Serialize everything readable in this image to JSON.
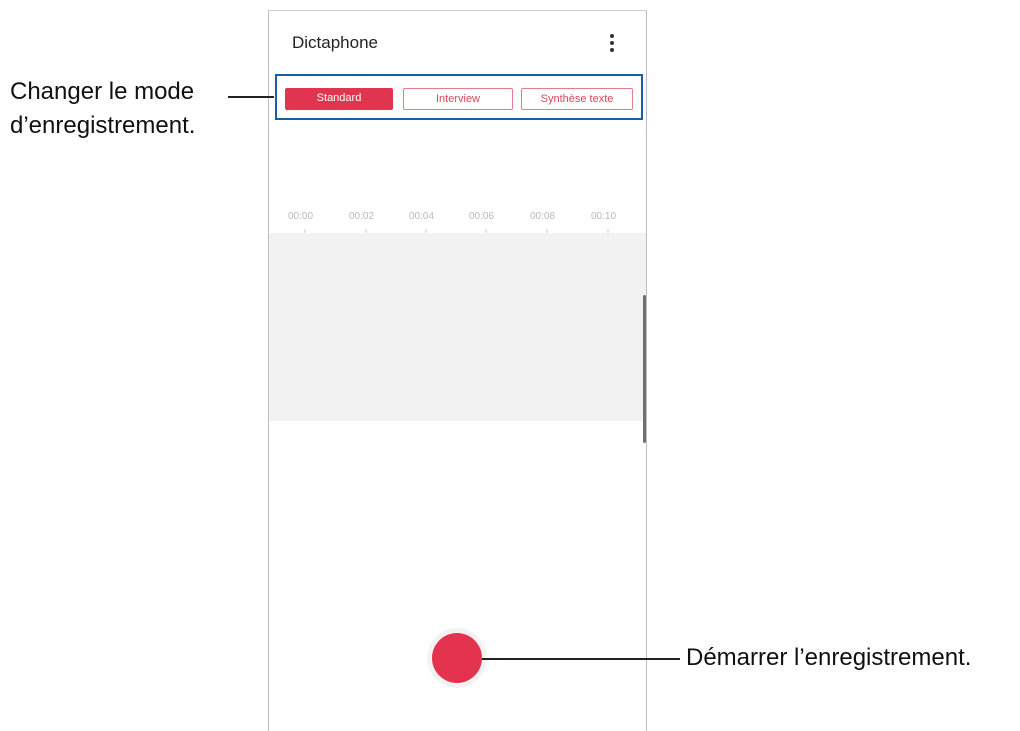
{
  "app": {
    "title": "Dictaphone",
    "menu_icon": "more-vert-icon"
  },
  "tabs": [
    {
      "label": "Standard",
      "active": true
    },
    {
      "label": "Interview",
      "active": false
    },
    {
      "label": "Synthèse texte",
      "active": false
    }
  ],
  "timeline": {
    "labels": [
      "00:00",
      "00:02",
      "00:04",
      "00:06",
      "00:08",
      "00:10"
    ]
  },
  "record_button": {
    "icon": "record-icon"
  },
  "annotations": {
    "mode_line1": "Changer le mode",
    "mode_line2": "d’enregistrement.",
    "start": "Démarrer l’enregistrement."
  },
  "colors": {
    "accent": "#e3334f",
    "highlight_border": "#1a5fa6"
  }
}
